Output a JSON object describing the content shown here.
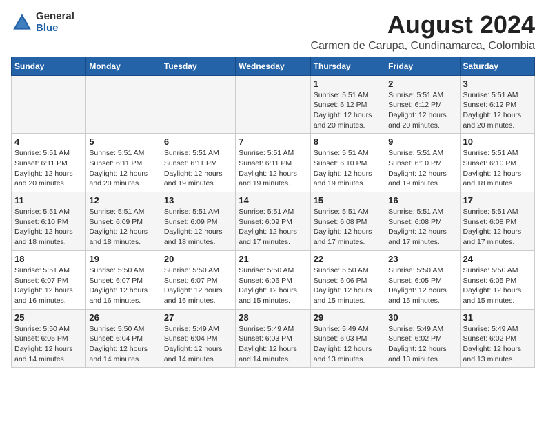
{
  "header": {
    "logo_general": "General",
    "logo_blue": "Blue",
    "main_title": "August 2024",
    "subtitle": "Carmen de Carupa, Cundinamarca, Colombia"
  },
  "days_of_week": [
    "Sunday",
    "Monday",
    "Tuesday",
    "Wednesday",
    "Thursday",
    "Friday",
    "Saturday"
  ],
  "weeks": [
    [
      {
        "day": "",
        "info": ""
      },
      {
        "day": "",
        "info": ""
      },
      {
        "day": "",
        "info": ""
      },
      {
        "day": "",
        "info": ""
      },
      {
        "day": "1",
        "info": "Sunrise: 5:51 AM\nSunset: 6:12 PM\nDaylight: 12 hours\nand 20 minutes."
      },
      {
        "day": "2",
        "info": "Sunrise: 5:51 AM\nSunset: 6:12 PM\nDaylight: 12 hours\nand 20 minutes."
      },
      {
        "day": "3",
        "info": "Sunrise: 5:51 AM\nSunset: 6:12 PM\nDaylight: 12 hours\nand 20 minutes."
      }
    ],
    [
      {
        "day": "4",
        "info": "Sunrise: 5:51 AM\nSunset: 6:11 PM\nDaylight: 12 hours\nand 20 minutes."
      },
      {
        "day": "5",
        "info": "Sunrise: 5:51 AM\nSunset: 6:11 PM\nDaylight: 12 hours\nand 20 minutes."
      },
      {
        "day": "6",
        "info": "Sunrise: 5:51 AM\nSunset: 6:11 PM\nDaylight: 12 hours\nand 19 minutes."
      },
      {
        "day": "7",
        "info": "Sunrise: 5:51 AM\nSunset: 6:11 PM\nDaylight: 12 hours\nand 19 minutes."
      },
      {
        "day": "8",
        "info": "Sunrise: 5:51 AM\nSunset: 6:10 PM\nDaylight: 12 hours\nand 19 minutes."
      },
      {
        "day": "9",
        "info": "Sunrise: 5:51 AM\nSunset: 6:10 PM\nDaylight: 12 hours\nand 19 minutes."
      },
      {
        "day": "10",
        "info": "Sunrise: 5:51 AM\nSunset: 6:10 PM\nDaylight: 12 hours\nand 18 minutes."
      }
    ],
    [
      {
        "day": "11",
        "info": "Sunrise: 5:51 AM\nSunset: 6:10 PM\nDaylight: 12 hours\nand 18 minutes."
      },
      {
        "day": "12",
        "info": "Sunrise: 5:51 AM\nSunset: 6:09 PM\nDaylight: 12 hours\nand 18 minutes."
      },
      {
        "day": "13",
        "info": "Sunrise: 5:51 AM\nSunset: 6:09 PM\nDaylight: 12 hours\nand 18 minutes."
      },
      {
        "day": "14",
        "info": "Sunrise: 5:51 AM\nSunset: 6:09 PM\nDaylight: 12 hours\nand 17 minutes."
      },
      {
        "day": "15",
        "info": "Sunrise: 5:51 AM\nSunset: 6:08 PM\nDaylight: 12 hours\nand 17 minutes."
      },
      {
        "day": "16",
        "info": "Sunrise: 5:51 AM\nSunset: 6:08 PM\nDaylight: 12 hours\nand 17 minutes."
      },
      {
        "day": "17",
        "info": "Sunrise: 5:51 AM\nSunset: 6:08 PM\nDaylight: 12 hours\nand 17 minutes."
      }
    ],
    [
      {
        "day": "18",
        "info": "Sunrise: 5:51 AM\nSunset: 6:07 PM\nDaylight: 12 hours\nand 16 minutes."
      },
      {
        "day": "19",
        "info": "Sunrise: 5:50 AM\nSunset: 6:07 PM\nDaylight: 12 hours\nand 16 minutes."
      },
      {
        "day": "20",
        "info": "Sunrise: 5:50 AM\nSunset: 6:07 PM\nDaylight: 12 hours\nand 16 minutes."
      },
      {
        "day": "21",
        "info": "Sunrise: 5:50 AM\nSunset: 6:06 PM\nDaylight: 12 hours\nand 15 minutes."
      },
      {
        "day": "22",
        "info": "Sunrise: 5:50 AM\nSunset: 6:06 PM\nDaylight: 12 hours\nand 15 minutes."
      },
      {
        "day": "23",
        "info": "Sunrise: 5:50 AM\nSunset: 6:05 PM\nDaylight: 12 hours\nand 15 minutes."
      },
      {
        "day": "24",
        "info": "Sunrise: 5:50 AM\nSunset: 6:05 PM\nDaylight: 12 hours\nand 15 minutes."
      }
    ],
    [
      {
        "day": "25",
        "info": "Sunrise: 5:50 AM\nSunset: 6:05 PM\nDaylight: 12 hours\nand 14 minutes."
      },
      {
        "day": "26",
        "info": "Sunrise: 5:50 AM\nSunset: 6:04 PM\nDaylight: 12 hours\nand 14 minutes."
      },
      {
        "day": "27",
        "info": "Sunrise: 5:49 AM\nSunset: 6:04 PM\nDaylight: 12 hours\nand 14 minutes."
      },
      {
        "day": "28",
        "info": "Sunrise: 5:49 AM\nSunset: 6:03 PM\nDaylight: 12 hours\nand 14 minutes."
      },
      {
        "day": "29",
        "info": "Sunrise: 5:49 AM\nSunset: 6:03 PM\nDaylight: 12 hours\nand 13 minutes."
      },
      {
        "day": "30",
        "info": "Sunrise: 5:49 AM\nSunset: 6:02 PM\nDaylight: 12 hours\nand 13 minutes."
      },
      {
        "day": "31",
        "info": "Sunrise: 5:49 AM\nSunset: 6:02 PM\nDaylight: 12 hours\nand 13 minutes."
      }
    ]
  ]
}
